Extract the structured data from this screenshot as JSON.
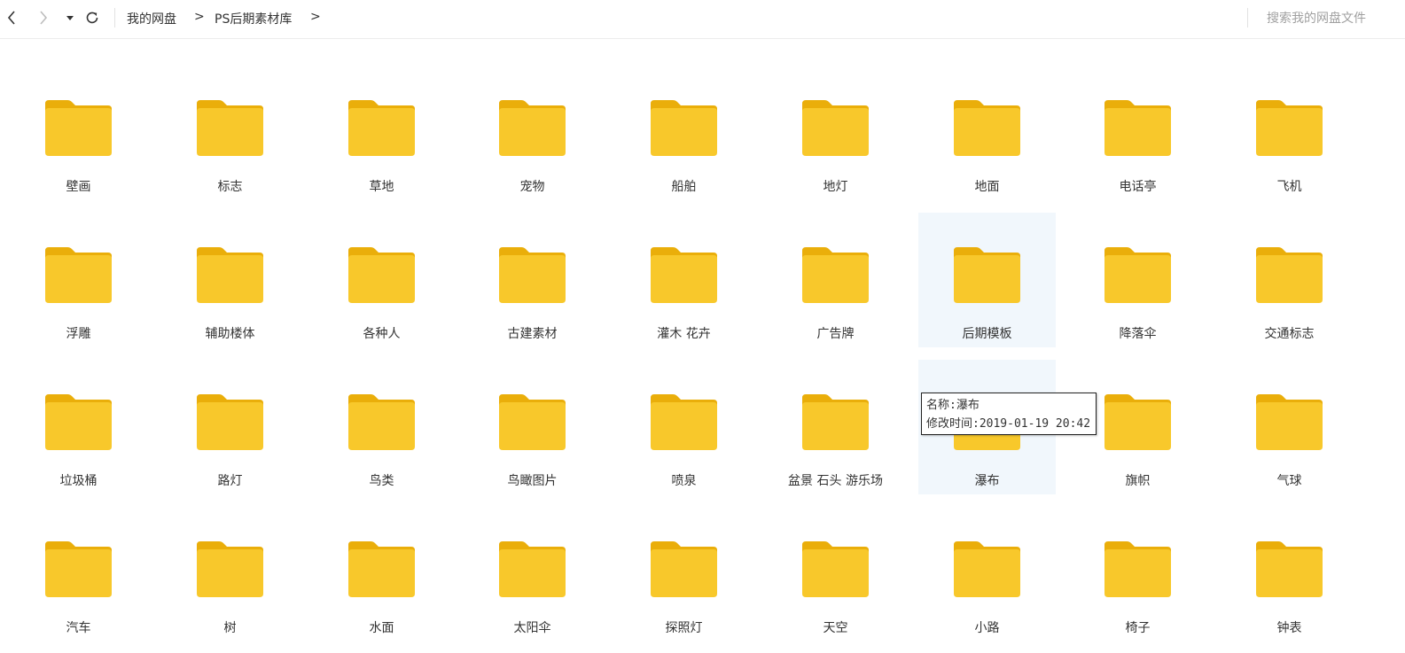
{
  "toolbar": {
    "back_icon": "chevron-left-icon",
    "forward_icon": "chevron-right-icon",
    "dropdown_icon": "caret-down-icon",
    "refresh_icon": "refresh-icon",
    "breadcrumb": [
      {
        "label": "我的网盘"
      },
      {
        "label": "PS后期素材库"
      }
    ],
    "separator": ">",
    "search_placeholder": "搜索我的网盘文件"
  },
  "colors": {
    "folder_body": "#F8C82B",
    "folder_tab": "#EAAE0A",
    "hover_bg": "#F1F7FC"
  },
  "folders": [
    {
      "name": "壁画"
    },
    {
      "name": "标志"
    },
    {
      "name": "草地"
    },
    {
      "name": "宠物"
    },
    {
      "name": "船舶"
    },
    {
      "name": "地灯"
    },
    {
      "name": "地面"
    },
    {
      "name": "电话亭"
    },
    {
      "name": "飞机"
    },
    {
      "name": "浮雕"
    },
    {
      "name": "辅助楼体"
    },
    {
      "name": "各种人"
    },
    {
      "name": "古建素材"
    },
    {
      "name": "灌木 花卉"
    },
    {
      "name": "广告牌"
    },
    {
      "name": "后期模板"
    },
    {
      "name": "降落伞"
    },
    {
      "name": "交通标志"
    },
    {
      "name": "垃圾桶"
    },
    {
      "name": "路灯"
    },
    {
      "name": "鸟类"
    },
    {
      "name": "鸟瞰图片"
    },
    {
      "name": "喷泉"
    },
    {
      "name": "盆景 石头 游乐场"
    },
    {
      "name": "瀑布"
    },
    {
      "name": "旗帜"
    },
    {
      "name": "气球"
    },
    {
      "name": "汽车"
    },
    {
      "name": "树"
    },
    {
      "name": "水面"
    },
    {
      "name": "太阳伞"
    },
    {
      "name": "探照灯"
    },
    {
      "name": "天空"
    },
    {
      "name": "小路"
    },
    {
      "name": "椅子"
    },
    {
      "name": "钟表"
    }
  ],
  "hovered": [
    "后期模板",
    "瀑布"
  ],
  "tooltip": {
    "line1": "名称:瀑布",
    "line2": "修改时间:2019-01-19 20:42"
  }
}
